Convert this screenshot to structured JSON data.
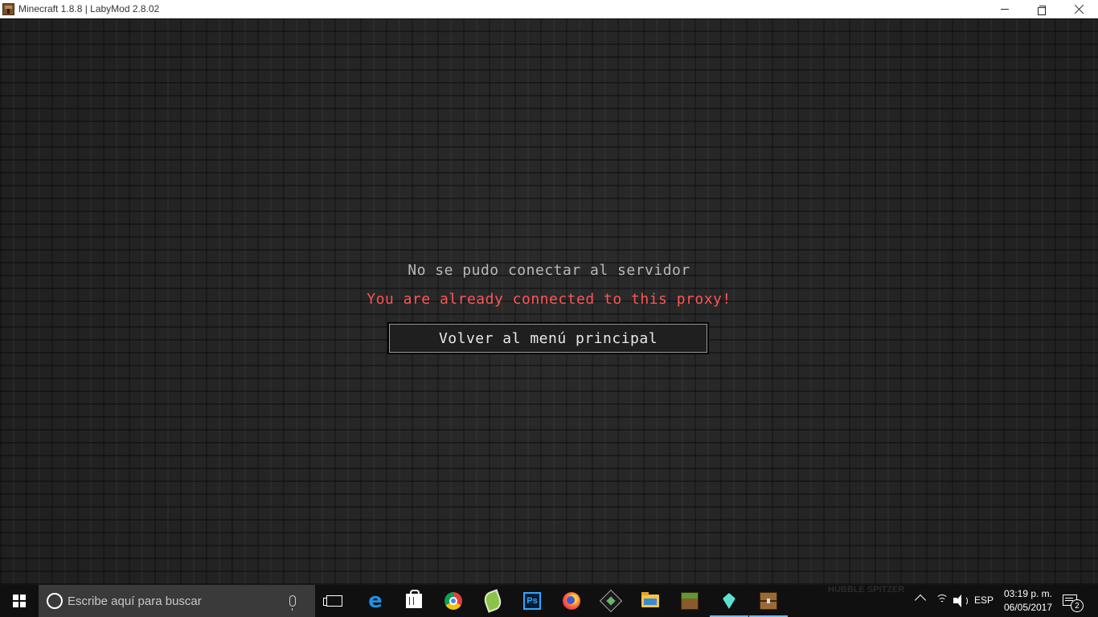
{
  "window": {
    "title": "Minecraft 1.8.8 | LabyMod 2.8.02",
    "app_icon": "crafting-table-icon"
  },
  "screen": {
    "title": "No se pudo conectar al servidor",
    "reason": "You are already connected to this proxy!",
    "reason_color": "#ff5555",
    "button_label": "Volver al menú principal"
  },
  "taskbar": {
    "search_placeholder": "Escribe aquí para buscar",
    "watermark": "HUBBLE SPITZER",
    "pinned": [
      {
        "name": "task-view-icon"
      },
      {
        "name": "edge-icon"
      },
      {
        "name": "store-icon"
      },
      {
        "name": "chrome-icon"
      },
      {
        "name": "leaf-app-icon"
      },
      {
        "name": "photoshop-icon",
        "label": "Ps"
      },
      {
        "name": "firefox-icon"
      },
      {
        "name": "mcedit-icon"
      },
      {
        "name": "file-explorer-icon"
      },
      {
        "name": "minecraft-grass-icon"
      },
      {
        "name": "diamond-icon"
      },
      {
        "name": "crafting-table-icon"
      }
    ],
    "tray": {
      "language": "ESP",
      "time": "03:19 p. m.",
      "date": "06/05/2017",
      "notification_count": "2"
    }
  }
}
